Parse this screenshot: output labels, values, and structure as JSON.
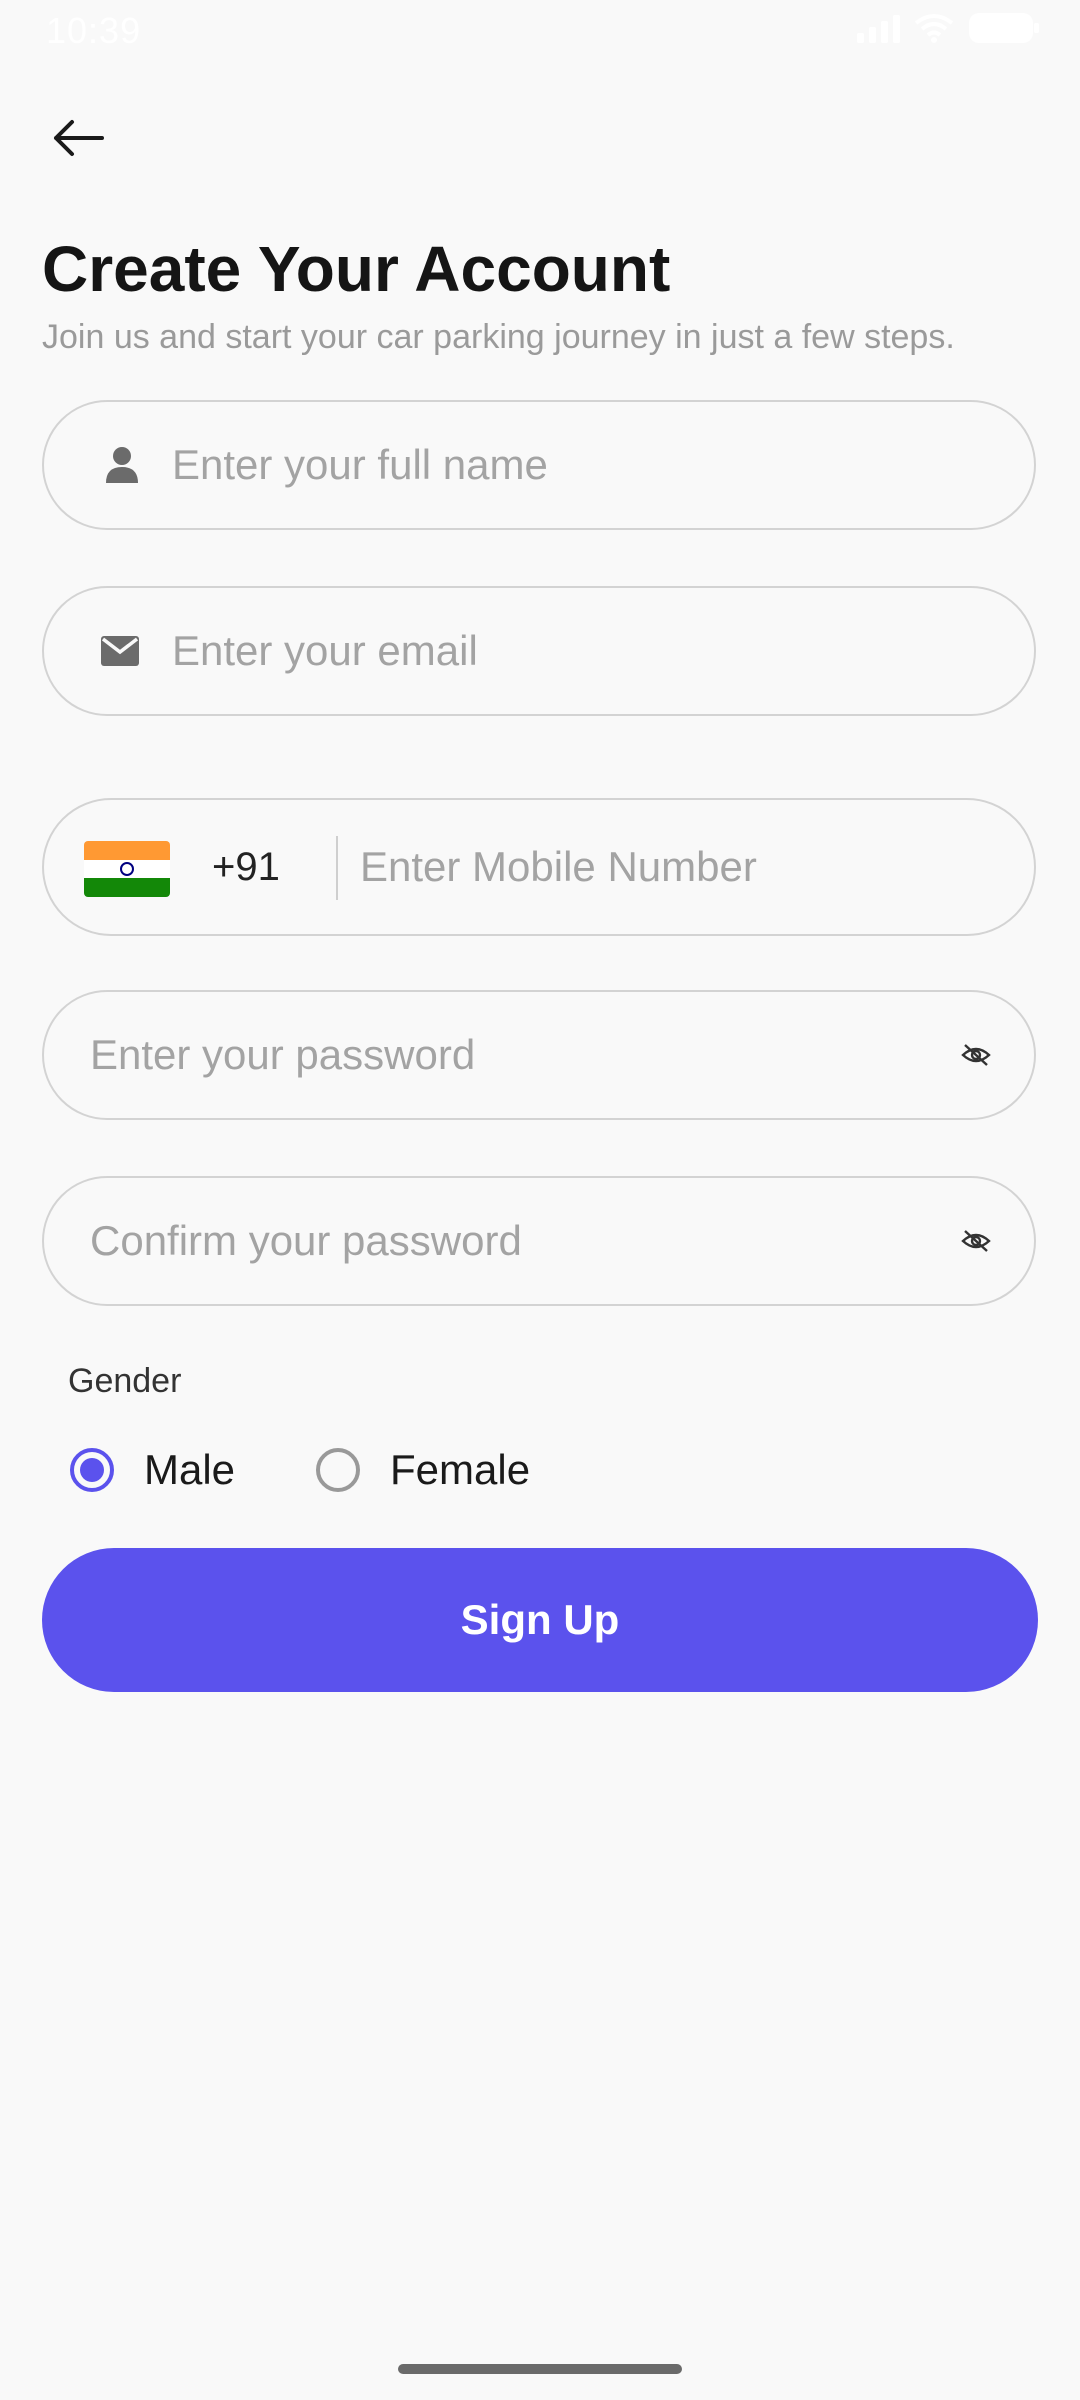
{
  "status_bar": {
    "time": "10:39"
  },
  "header": {
    "back_icon": "arrow-left-icon",
    "title": "Create Your Account",
    "subtitle": "Join us and start your car parking journey in just a few steps."
  },
  "form": {
    "full_name": {
      "placeholder": "Enter your full name",
      "value": "",
      "icon": "person-icon"
    },
    "email": {
      "placeholder": "Enter your email",
      "value": "",
      "icon": "mail-icon"
    },
    "phone": {
      "flag": "india-flag-icon",
      "dial_code": "+91",
      "placeholder": "Enter Mobile Number",
      "value": ""
    },
    "password": {
      "placeholder": "Enter your password",
      "value": "",
      "icon": "eye-off-icon"
    },
    "confirm_password": {
      "placeholder": "Confirm your password",
      "value": "",
      "icon": "eye-off-icon"
    },
    "gender": {
      "label": "Gender",
      "options": [
        {
          "label": "Male",
          "selected": true
        },
        {
          "label": "Female",
          "selected": false
        }
      ]
    },
    "submit_label": "Sign Up"
  },
  "colors": {
    "accent": "#5b52ed",
    "background": "#f9f9f9",
    "border": "#d3d3d3",
    "placeholder": "#a3a3a3"
  }
}
